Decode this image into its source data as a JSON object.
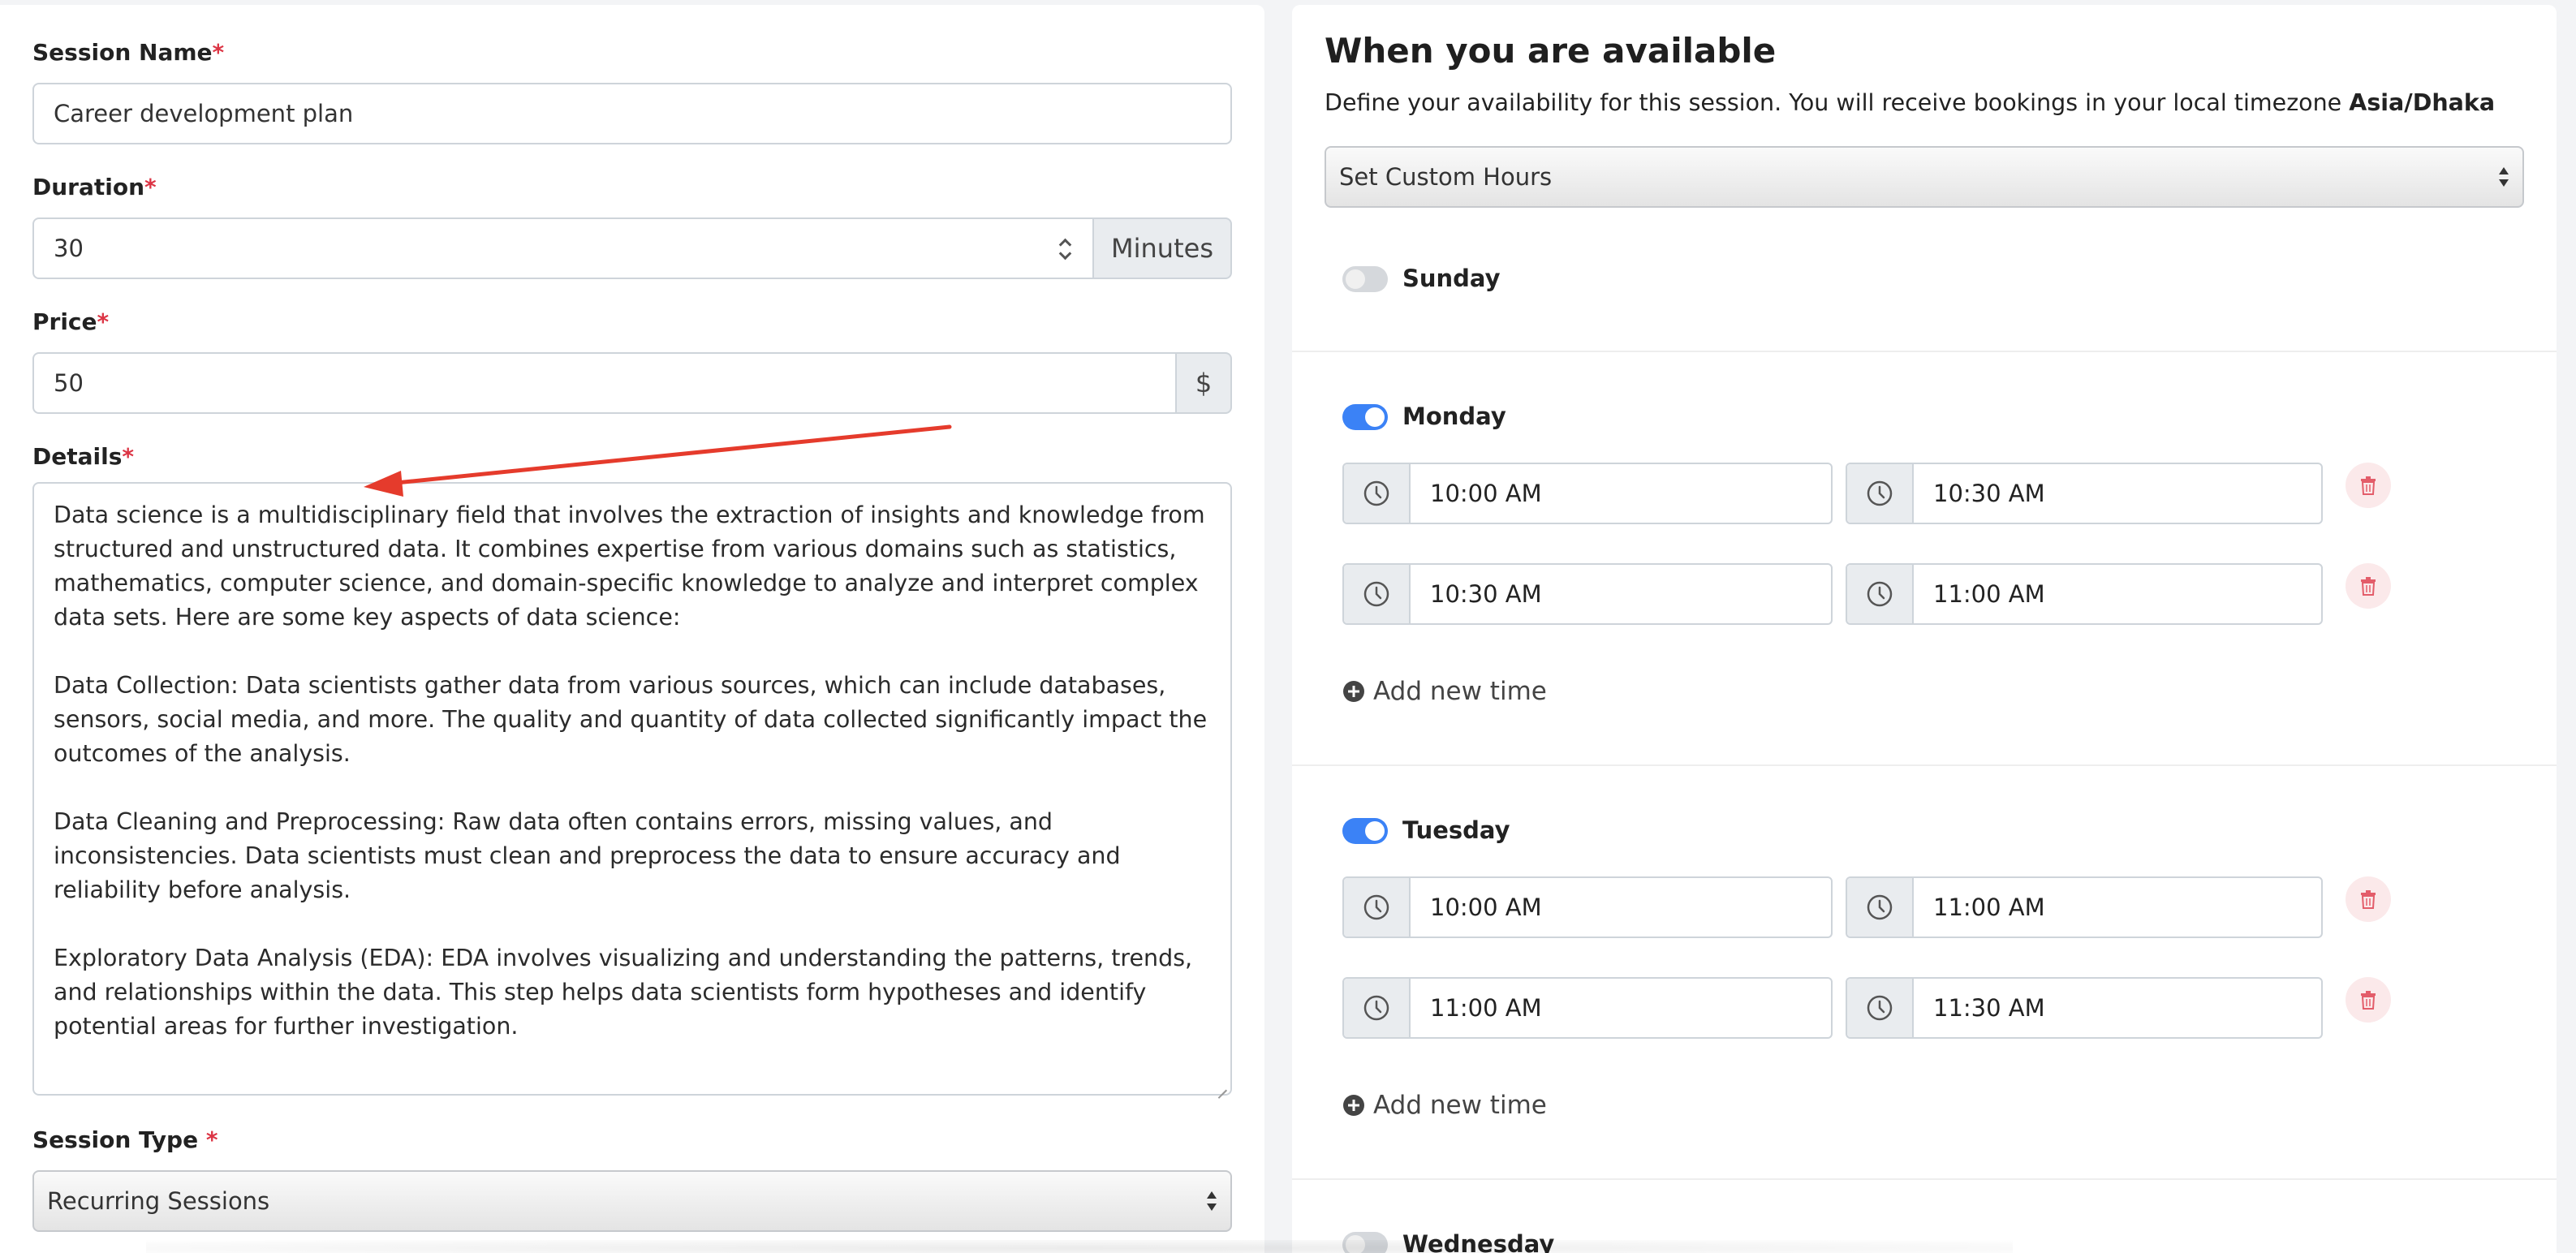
{
  "form": {
    "session_name": {
      "label": "Session Name",
      "required": "*",
      "value": "Career  development plan"
    },
    "duration": {
      "label": "Duration",
      "required": "*",
      "value": "30",
      "unit": "Minutes"
    },
    "price": {
      "label": "Price",
      "required": "*",
      "value": "50",
      "currency": "$"
    },
    "details": {
      "label": "Details",
      "required": "*",
      "value": "Data science is a multidisciplinary field that involves the extraction of insights and knowledge from structured and unstructured data. It combines expertise from various domains such as statistics, mathematics, computer science, and domain-specific knowledge to analyze and interpret complex data sets. Here are some key aspects of data science:\n\nData Collection: Data scientists gather data from various sources, which can include databases, sensors, social media, and more. The quality and quantity of data collected significantly impact the outcomes of the analysis.\n\nData Cleaning and Preprocessing: Raw data often contains errors, missing values, and inconsistencies. Data scientists must clean and preprocess the data to ensure accuracy and reliability before analysis.\n\nExploratory Data Analysis (EDA): EDA involves visualizing and understanding the patterns, trends, and relationships within the data. This step helps data scientists form hypotheses and identify potential areas for further investigation."
    },
    "session_type": {
      "label": "Session Type ",
      "required": "*",
      "value": "Recurring Sessions"
    }
  },
  "availability": {
    "title": "When you are available",
    "description": "Define your availability for this session. You will receive bookings in your local timezone ",
    "timezone": "Asia/Dhaka",
    "hours_select": "Set Custom Hours",
    "add_time_label": "Add new time",
    "days": [
      {
        "name": "Sunday",
        "enabled": false
      },
      {
        "name": "Monday",
        "enabled": true,
        "slots": [
          {
            "start": "10:00 AM",
            "end": "10:30 AM"
          },
          {
            "start": "10:30 AM",
            "end": "11:00 AM"
          }
        ]
      },
      {
        "name": "Tuesday",
        "enabled": true,
        "slots": [
          {
            "start": "10:00 AM",
            "end": "11:00 AM"
          },
          {
            "start": "11:00 AM",
            "end": "11:30 AM"
          }
        ]
      },
      {
        "name": "Wednesday",
        "enabled": false
      }
    ]
  },
  "colors": {
    "accent": "#3b82f6",
    "required": "#dc3545",
    "annotation_arrow": "#e53b2c",
    "delete": "#e35d6a"
  },
  "icons": {
    "time": "clock-icon",
    "delete": "trash-icon",
    "add": "plus-circle-icon"
  }
}
